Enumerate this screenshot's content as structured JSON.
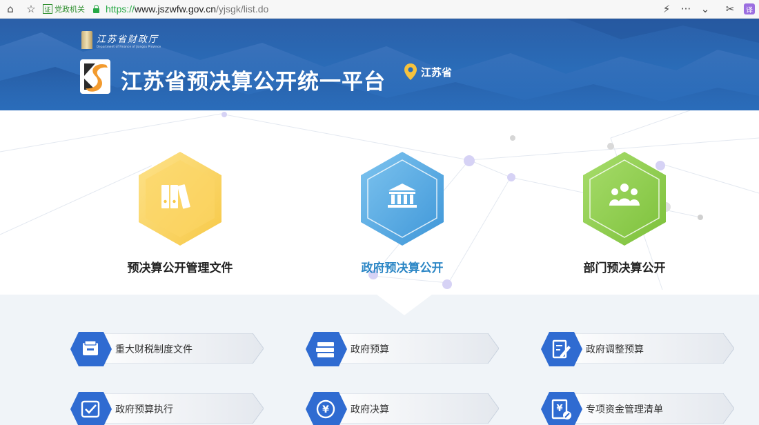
{
  "browser": {
    "gov_badge": "党政机关",
    "gov_badge_icon": "证",
    "url_protocol": "https://",
    "url_host": "www.jszwfw.gov.cn",
    "url_path": "/yjsgk/list.do",
    "ext_label": "译"
  },
  "header": {
    "dept_name_cn": "江苏省财政厅",
    "dept_name_en": "Department of Finance of Jiangsu Province",
    "platform_title": "江苏省预决算公开统一平台",
    "region": "江苏省"
  },
  "categories": [
    {
      "label": "预决算公开管理文件",
      "icon": "binders-icon",
      "color": "#f7c948",
      "active": false
    },
    {
      "label": "政府预决算公开",
      "icon": "government-building-icon",
      "color": "#4aa3df",
      "active": true
    },
    {
      "label": "部门预决算公开",
      "icon": "people-group-icon",
      "color": "#8cc63f",
      "active": false
    }
  ],
  "menu": [
    {
      "label": "重大财税制度文件",
      "icon": "inbox-tray-icon"
    },
    {
      "label": "政府预算",
      "icon": "stacked-books-icon"
    },
    {
      "label": "政府调整预算",
      "icon": "edit-document-icon"
    },
    {
      "label": "政府预算执行",
      "icon": "check-document-icon"
    },
    {
      "label": "政府决算",
      "icon": "yen-cycle-icon"
    },
    {
      "label": "专项资金管理清单",
      "icon": "yen-document-icon"
    }
  ],
  "colors": {
    "banner": "#2a6cb8",
    "active_text": "#2b86c5",
    "menu_icon": "#2f6bd1"
  }
}
